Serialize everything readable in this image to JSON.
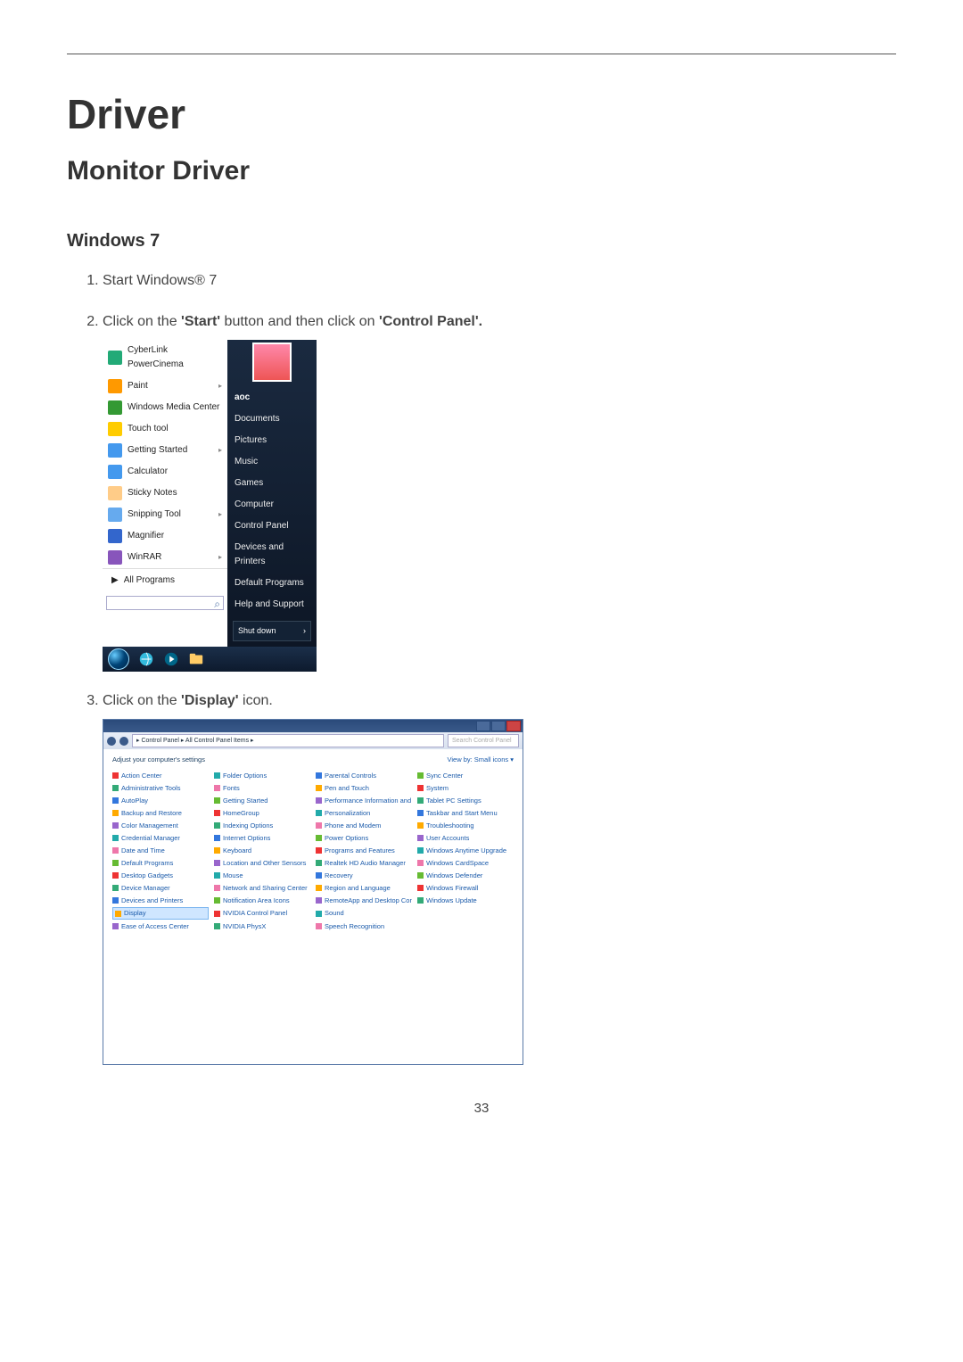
{
  "page": {
    "title": "Driver",
    "subtitle": "Monitor Driver",
    "section": "Windows 7",
    "page_number": "33"
  },
  "steps": {
    "s1": "Start Windows® 7",
    "s2_pre": "Click on the ",
    "s2_b1": "'Start'",
    "s2_mid": " button and then click on ",
    "s2_b2": "'Control Panel'.",
    "s3_pre": "Click on the ",
    "s3_b1": "'Display'",
    "s3_post": " icon."
  },
  "startmenu": {
    "left": [
      "CyberLink PowerCinema",
      "Paint",
      "Windows Media Center",
      "Touch tool",
      "Getting Started",
      "Calculator",
      "Sticky Notes",
      "Snipping Tool",
      "Magnifier",
      "WinRAR"
    ],
    "all_programs": "All Programs",
    "right_user": "aoc",
    "right": [
      "Documents",
      "Pictures",
      "Music",
      "Games",
      "Computer",
      "Control Panel",
      "Devices and Printers",
      "Default Programs",
      "Help and Support"
    ],
    "shutdown": "Shut down"
  },
  "cp": {
    "path": "▸ Control Panel ▸ All Control Panel Items ▸",
    "search_placeholder": "Search Control Panel",
    "adjust": "Adjust your computer's settings",
    "viewby": "View by:  Small icons ▾",
    "items": [
      "Action Center",
      "Administrative Tools",
      "AutoPlay",
      "Backup and Restore",
      "Color Management",
      "Credential Manager",
      "Date and Time",
      "Default Programs",
      "Desktop Gadgets",
      "Device Manager",
      "Devices and Printers",
      "Display",
      "Ease of Access Center",
      "Folder Options",
      "Fonts",
      "Getting Started",
      "HomeGroup",
      "Indexing Options",
      "Internet Options",
      "Keyboard",
      "Location and Other Sensors",
      "Mouse",
      "Network and Sharing Center",
      "Notification Area Icons",
      "NVIDIA Control Panel",
      "NVIDIA PhysX",
      "Parental Controls",
      "Pen and Touch",
      "Performance Information and Tools",
      "Personalization",
      "Phone and Modem",
      "Power Options",
      "Programs and Features",
      "Realtek HD Audio Manager",
      "Recovery",
      "Region and Language",
      "RemoteApp and Desktop Connections",
      "Sound",
      "Speech Recognition",
      "Sync Center",
      "System",
      "Tablet PC Settings",
      "Taskbar and Start Menu",
      "Troubleshooting",
      "User Accounts",
      "Windows Anytime Upgrade",
      "Windows CardSpace",
      "Windows Defender",
      "Windows Firewall",
      "Windows Update"
    ],
    "highlight": "Display"
  },
  "icon_colors": [
    "#2a7",
    "#f90",
    "#393",
    "#fc0",
    "#49e",
    "#49e",
    "#fc8",
    "#6ae",
    "#36c",
    "#85b"
  ]
}
